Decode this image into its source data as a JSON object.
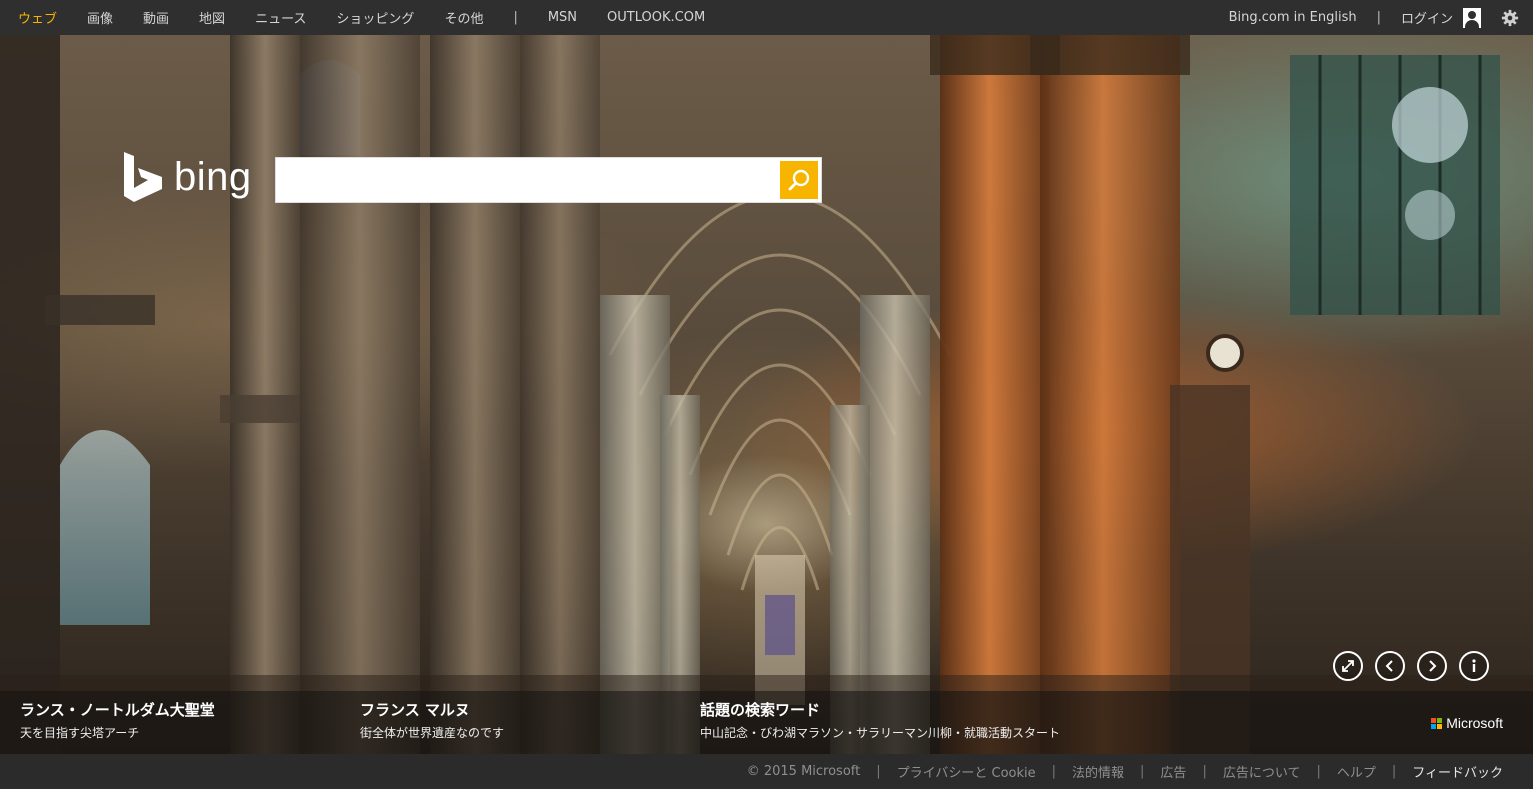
{
  "nav": {
    "items": [
      {
        "label": "ウェブ",
        "active": true
      },
      {
        "label": "画像"
      },
      {
        "label": "動画"
      },
      {
        "label": "地図"
      },
      {
        "label": "ニュース"
      },
      {
        "label": "ショッピング"
      },
      {
        "label": "その他"
      }
    ],
    "separator": "|",
    "extra": [
      "MSN",
      "OUTLOOK.COM"
    ],
    "english_link": "Bing.com in English",
    "login": "ログイン"
  },
  "logo": {
    "text": "bing"
  },
  "search": {
    "value": "",
    "placeholder": ""
  },
  "captions": [
    {
      "title": "ランス・ノートルダム大聖堂",
      "subtitle": "天を目指す尖塔アーチ"
    },
    {
      "title": "フランス マルヌ",
      "subtitle": "街全体が世界遺産なのです"
    },
    {
      "title": "話題の検索ワード",
      "subtitle": "中山記念・びわ湖マラソン・サラリーマン川柳・就職活動スタート"
    }
  ],
  "brand": "Microsoft",
  "colors": {
    "accent": "#f7b500",
    "topbar": "#2f2f2f",
    "footer": "#2b2b2b"
  },
  "controls": [
    "expand-icon",
    "previous-icon",
    "next-icon",
    "info-icon"
  ],
  "footer": {
    "links": [
      "© 2015 Microsoft",
      "プライバシーと Cookie",
      "法的情報",
      "広告",
      "広告について",
      "ヘルプ",
      "フィードバック"
    ]
  }
}
